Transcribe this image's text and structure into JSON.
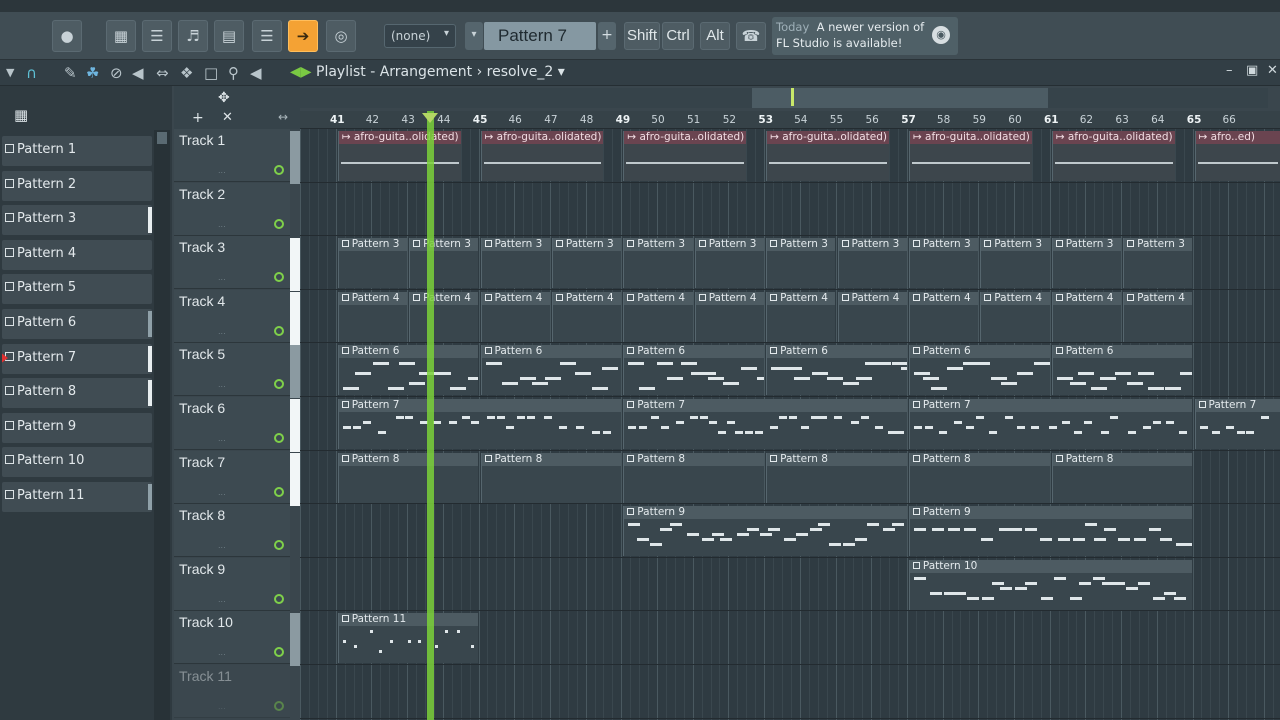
{
  "toolbar": {
    "pattern_select": "(none)",
    "pattern_name": "Pattern 7",
    "shift_label": "Shift",
    "ctrl_label": "Ctrl",
    "alt_label": "Alt",
    "hint_when": "Today",
    "hint_text1": "A newer version of",
    "hint_text2": "FL Studio is available!"
  },
  "window": {
    "title_prefix": "Playlist - Arrangement",
    "title_arrow": "›",
    "project": "resolve_2"
  },
  "patterns": [
    {
      "label": "Pattern 1"
    },
    {
      "label": "Pattern 2"
    },
    {
      "label": "Pattern 3"
    },
    {
      "label": "Pattern 4"
    },
    {
      "label": "Pattern 5"
    },
    {
      "label": "Pattern 6"
    },
    {
      "label": "Pattern 7"
    },
    {
      "label": "Pattern 8"
    },
    {
      "label": "Pattern 9"
    },
    {
      "label": "Pattern 10"
    },
    {
      "label": "Pattern 11"
    }
  ],
  "selected_pattern": "Pattern 7",
  "ruler": {
    "bars": [
      "41",
      "42",
      "43",
      "44",
      "45",
      "46",
      "47",
      "48",
      "49",
      "50",
      "51",
      "52",
      "53",
      "54",
      "55",
      "56",
      "57",
      "58",
      "59",
      "60",
      "61",
      "62",
      "63",
      "64",
      "65",
      "66"
    ]
  },
  "tracks": [
    {
      "label": "Track 1"
    },
    {
      "label": "Track 2"
    },
    {
      "label": "Track 3"
    },
    {
      "label": "Track 4"
    },
    {
      "label": "Track 5"
    },
    {
      "label": "Track 6"
    },
    {
      "label": "Track 7"
    },
    {
      "label": "Track 8"
    },
    {
      "label": "Track 9"
    },
    {
      "label": "Track 10"
    },
    {
      "label": "Track 11"
    }
  ],
  "clip_names": {
    "audio": "afro-guita..olidated)",
    "audio_short": "afro..ed)",
    "p3": "Pattern 3",
    "p4": "Pattern 4",
    "p6": "Pattern 6",
    "p7": "Pattern 7",
    "p8": "Pattern 8",
    "p9": "Pattern 9",
    "p10": "Pattern 10",
    "p11": "Pattern 11"
  },
  "colors": {
    "playhead": "#7bd13a",
    "accent": "#f4a234",
    "audio_clip": "#6a4450"
  }
}
